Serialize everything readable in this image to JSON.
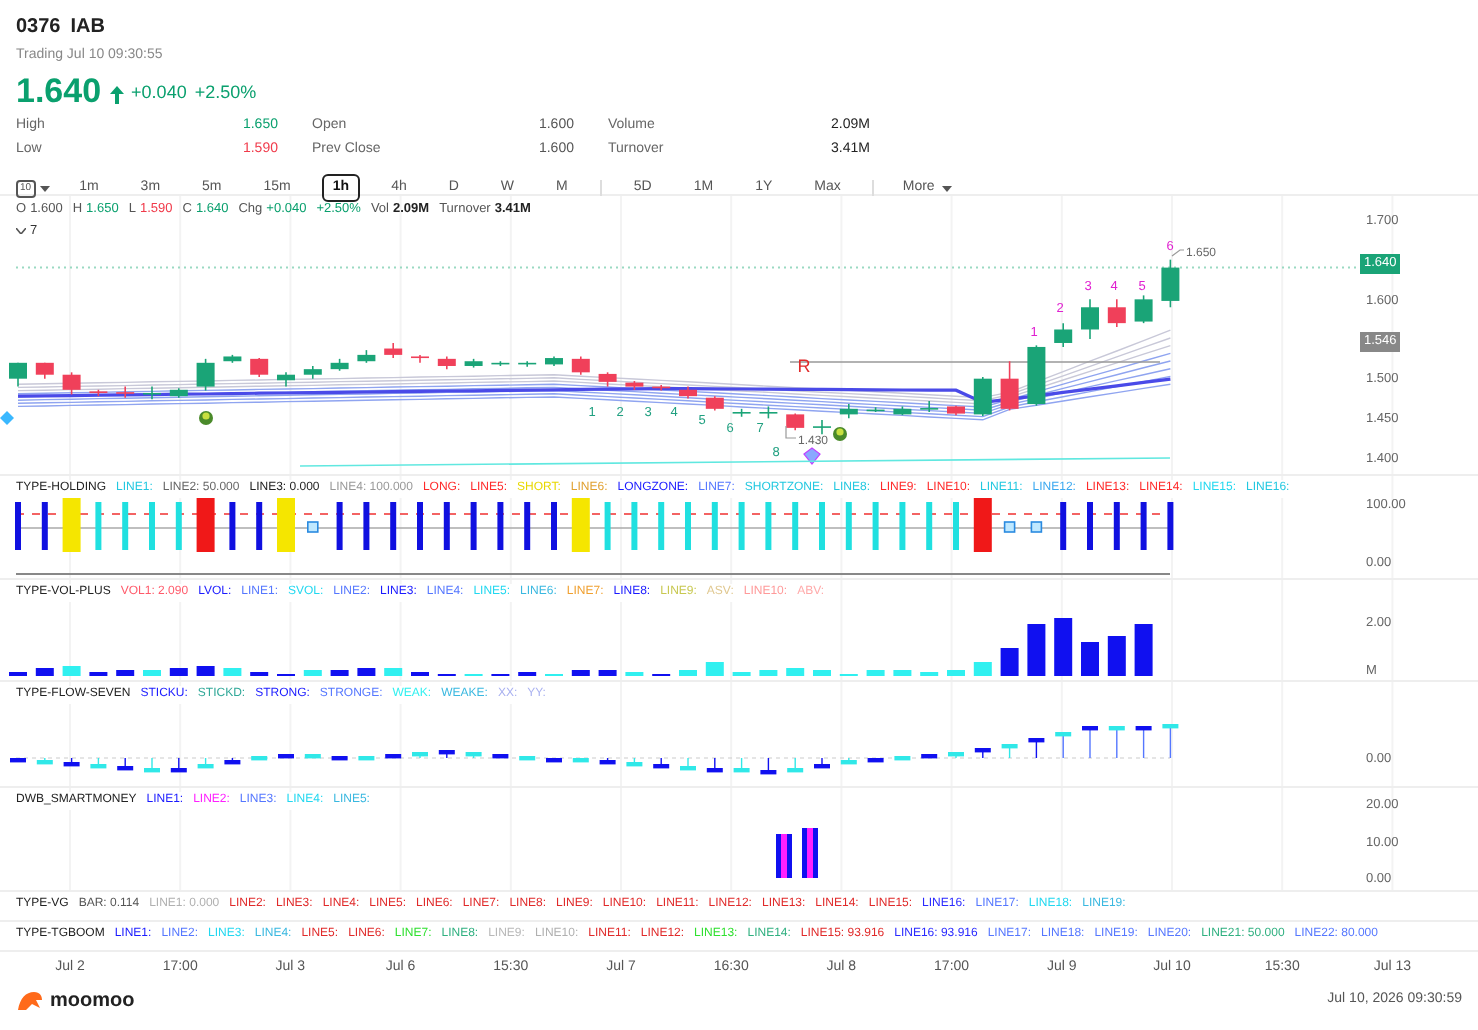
{
  "header": {
    "symbol": "0376",
    "name": "IAB",
    "status": "Trading Jul 10 09:30:55",
    "price": "1.640",
    "change": "+0.040",
    "change_pct": "+2.50%"
  },
  "stats": [
    {
      "label": "High",
      "value": "1.650",
      "color": "#0aa06e"
    },
    {
      "label": "Open",
      "value": "1.600",
      "color": "#555555"
    },
    {
      "label": "Volume",
      "value": "2.09M",
      "color": "#222222"
    },
    {
      "label": "Low",
      "value": "1.590",
      "color": "#f03a4a"
    },
    {
      "label": "Prev Close",
      "value": "1.600",
      "color": "#555555"
    },
    {
      "label": "Turnover",
      "value": "3.41M",
      "color": "#222222"
    }
  ],
  "chart_type": {
    "label": "10"
  },
  "period_groups": [
    [
      {
        "label": "1m",
        "selected": false
      },
      {
        "label": "3m",
        "selected": false
      },
      {
        "label": "5m",
        "selected": false
      },
      {
        "label": "15m",
        "selected": false
      },
      {
        "label": "1h",
        "selected": true
      },
      {
        "label": "4h",
        "selected": false
      },
      {
        "label": "D",
        "selected": false
      },
      {
        "label": "W",
        "selected": false
      },
      {
        "label": "M",
        "selected": false
      }
    ],
    [
      {
        "label": "5D",
        "selected": false
      },
      {
        "label": "1M",
        "selected": false
      },
      {
        "label": "1Y",
        "selected": false
      },
      {
        "label": "Max",
        "selected": false
      }
    ]
  ],
  "more": {
    "label": "More"
  },
  "ohlc": [
    {
      "label": "O",
      "value": "1.600",
      "color": "#555555"
    },
    {
      "label": "H",
      "value": "1.650",
      "color": "#0aa06e"
    },
    {
      "label": "L",
      "value": "1.590",
      "color": "#f03a4a"
    },
    {
      "label": "C",
      "value": "1.640",
      "color": "#0aa06e"
    },
    {
      "label": "Chg",
      "value": "+0.040",
      "color": "#0aa06e"
    },
    {
      "value": "+2.50%",
      "color": "#0aa06e"
    },
    {
      "label": "Vol",
      "value": "2.09M",
      "color": "#222222"
    },
    {
      "label": "Turnover",
      "value": "3.41M",
      "color": "#222222"
    }
  ],
  "collapsed_count": "7",
  "price_axis": [
    "1.700",
    "1.600",
    "1.500",
    "1.450",
    "1.400"
  ],
  "last_price": "1.640",
  "reference_price": "1.546",
  "high_label": "1.650",
  "low_label": "1.430",
  "resistance_label": "R",
  "down_counts": [
    "1",
    "2",
    "3",
    "4",
    "5",
    "6",
    "7",
    "8"
  ],
  "up_counts": [
    "1",
    "2",
    "3",
    "4",
    "5",
    "6"
  ],
  "indicators": [
    {
      "name": "TYPE-HOLDING",
      "kind": "holding",
      "axis": [
        "100.00",
        "0.00"
      ],
      "lines": [
        {
          "label": "LINE1:",
          "color": "#22c8e0"
        },
        {
          "label": "LINE2: 50.000",
          "color": "#666666"
        },
        {
          "label": "LINE3: 0.000",
          "color": "#222222"
        },
        {
          "label": "LINE4: 100.000",
          "color": "#999999"
        },
        {
          "label": "LONG:",
          "color": "#ff2a2a"
        },
        {
          "label": "LINE5:",
          "color": "#ff2a2a"
        },
        {
          "label": "SHORT:",
          "color": "#e8d800"
        },
        {
          "label": "LINE6:",
          "color": "#e0a030"
        },
        {
          "label": "LONGZONE:",
          "color": "#1a1aff"
        },
        {
          "label": "LINE7:",
          "color": "#5577ff"
        },
        {
          "label": "SHORTZONE:",
          "color": "#22c8e0"
        },
        {
          "label": "LINE8:",
          "color": "#22c8e0"
        },
        {
          "label": "LINE9:",
          "color": "#ff2a2a"
        },
        {
          "label": "LINE10:",
          "color": "#ff2a2a"
        },
        {
          "label": "LINE11:",
          "color": "#22c8e0"
        },
        {
          "label": "LINE12:",
          "color": "#3aa8f0"
        },
        {
          "label": "LINE13:",
          "color": "#ff2a2a"
        },
        {
          "label": "LINE14:",
          "color": "#ff2a2a"
        },
        {
          "label": "LINE15:",
          "color": "#22d8f0"
        },
        {
          "label": "LINE16:",
          "color": "#22c8e0"
        }
      ]
    },
    {
      "name": "TYPE-VOL-PLUS",
      "kind": "volume",
      "axis": [
        "2.00",
        "M"
      ],
      "lines": [
        {
          "label": "VOL1: 2.090",
          "color": "#ff5a6a"
        },
        {
          "label": "LVOL:",
          "color": "#1a1aff"
        },
        {
          "label": "LINE1:",
          "color": "#5577ff"
        },
        {
          "label": "SVOL:",
          "color": "#22d8f0"
        },
        {
          "label": "LINE2:",
          "color": "#5577ff"
        },
        {
          "label": "LINE3:",
          "color": "#1a1aff"
        },
        {
          "label": "LINE4:",
          "color": "#5577ff"
        },
        {
          "label": "LINE5:",
          "color": "#22d8f0"
        },
        {
          "label": "LINE6:",
          "color": "#3ab8e0"
        },
        {
          "label": "LINE7:",
          "color": "#f0a030"
        },
        {
          "label": "LINE8:",
          "color": "#1a1aff"
        },
        {
          "label": "LINE9:",
          "color": "#c8c850"
        },
        {
          "label": "ASV:",
          "color": "#e0c890"
        },
        {
          "label": "LINE10:",
          "color": "#ff9a9a"
        },
        {
          "label": "ABV:",
          "color": "#ffaaaa"
        }
      ]
    },
    {
      "name": "TYPE-FLOW-SEVEN",
      "kind": "flow",
      "axis": [
        "0.00"
      ],
      "lines": [
        {
          "label": "STICKU:",
          "color": "#1a1aff"
        },
        {
          "label": "STICKD:",
          "color": "#30a898"
        },
        {
          "label": "STRONG:",
          "color": "#1a1aff"
        },
        {
          "label": "STRONGE:",
          "color": "#5577ff"
        },
        {
          "label": "WEAK:",
          "color": "#30f0f0"
        },
        {
          "label": "WEAKE:",
          "color": "#3ab8e0"
        },
        {
          "label": "XX:",
          "color": "#a8b0f0"
        },
        {
          "label": "YY:",
          "color": "#a8b0f0"
        }
      ]
    },
    {
      "name": "DWB_SMARTMONEY",
      "kind": "smartmoney",
      "axis": [
        "20.00",
        "10.00",
        "0.00"
      ],
      "lines": [
        {
          "label": "LINE1:",
          "color": "#1a1aff"
        },
        {
          "label": "LINE2:",
          "color": "#ff20ff"
        },
        {
          "label": "LINE3:",
          "color": "#5577ff"
        },
        {
          "label": "LINE4:",
          "color": "#22d8f0"
        },
        {
          "label": "LINE5:",
          "color": "#3ab8e0"
        }
      ]
    },
    {
      "name": "TYPE-VG",
      "kind": "legend",
      "lines": [
        {
          "label": "BAR: 0.114",
          "color": "#555555"
        },
        {
          "label": "LINE1: 0.000",
          "color": "#b0b0b0"
        },
        {
          "label": "LINE2:",
          "color": "#e02a2a"
        },
        {
          "label": "LINE3:",
          "color": "#e02a2a"
        },
        {
          "label": "LINE4:",
          "color": "#e02a2a"
        },
        {
          "label": "LINE5:",
          "color": "#e02a2a"
        },
        {
          "label": "LINE6:",
          "color": "#e02a2a"
        },
        {
          "label": "LINE7:",
          "color": "#e02a2a"
        },
        {
          "label": "LINE8:",
          "color": "#e02a2a"
        },
        {
          "label": "LINE9:",
          "color": "#e02a2a"
        },
        {
          "label": "LINE10:",
          "color": "#e02a2a"
        },
        {
          "label": "LINE11:",
          "color": "#e02a2a"
        },
        {
          "label": "LINE12:",
          "color": "#e02a2a"
        },
        {
          "label": "LINE13:",
          "color": "#e02a2a"
        },
        {
          "label": "LINE14:",
          "color": "#e02a2a"
        },
        {
          "label": "LINE15:",
          "color": "#e02a2a"
        },
        {
          "label": "LINE16:",
          "color": "#2a2aff"
        },
        {
          "label": "LINE17:",
          "color": "#5577ff"
        },
        {
          "label": "LINE18:",
          "color": "#22d8f0"
        },
        {
          "label": "LINE19:",
          "color": "#3ab8e0"
        }
      ]
    },
    {
      "name": "TYPE-TGBOOM",
      "kind": "legend",
      "lines": [
        {
          "label": "LINE1:",
          "color": "#1a1aff"
        },
        {
          "label": "LINE2:",
          "color": "#5577ff"
        },
        {
          "label": "LINE3:",
          "color": "#22d8f0"
        },
        {
          "label": "LINE4:",
          "color": "#3ab8e0"
        },
        {
          "label": "LINE5:",
          "color": "#e02a2a"
        },
        {
          "label": "LINE6:",
          "color": "#e02a2a"
        },
        {
          "label": "LINE7:",
          "color": "#30e030"
        },
        {
          "label": "LINE8:",
          "color": "#30b080"
        },
        {
          "label": "LINE9:",
          "color": "#b8b8b8"
        },
        {
          "label": "LINE10:",
          "color": "#b0b0b0"
        },
        {
          "label": "LINE11:",
          "color": "#e02a2a"
        },
        {
          "label": "LINE12:",
          "color": "#e02a2a"
        },
        {
          "label": "LINE13:",
          "color": "#30e030"
        },
        {
          "label": "LINE14:",
          "color": "#30b080"
        },
        {
          "label": "LINE15: 93.916",
          "color": "#e02a2a"
        },
        {
          "label": "LINE16: 93.916",
          "color": "#2a2aff"
        },
        {
          "label": "LINE17:",
          "color": "#5577ff"
        },
        {
          "label": "LINE18:",
          "color": "#5577ff"
        },
        {
          "label": "LINE19:",
          "color": "#5577ff"
        },
        {
          "label": "LINE20:",
          "color": "#5577ff"
        },
        {
          "label": "LINE21: 50.000",
          "color": "#30b080"
        },
        {
          "label": "LINE22: 80.000",
          "color": "#5577ff"
        }
      ]
    }
  ],
  "time_axis": [
    "Jul 2",
    "17:00",
    "Jul 3",
    "Jul 6",
    "15:30",
    "Jul 7",
    "16:30",
    "Jul 8",
    "17:00",
    "Jul 9",
    "Jul 10",
    "15:30",
    "Jul 13"
  ],
  "footer": {
    "brand": "moomoo",
    "timestamp": "Jul 10, 2026 09:30:59"
  }
}
